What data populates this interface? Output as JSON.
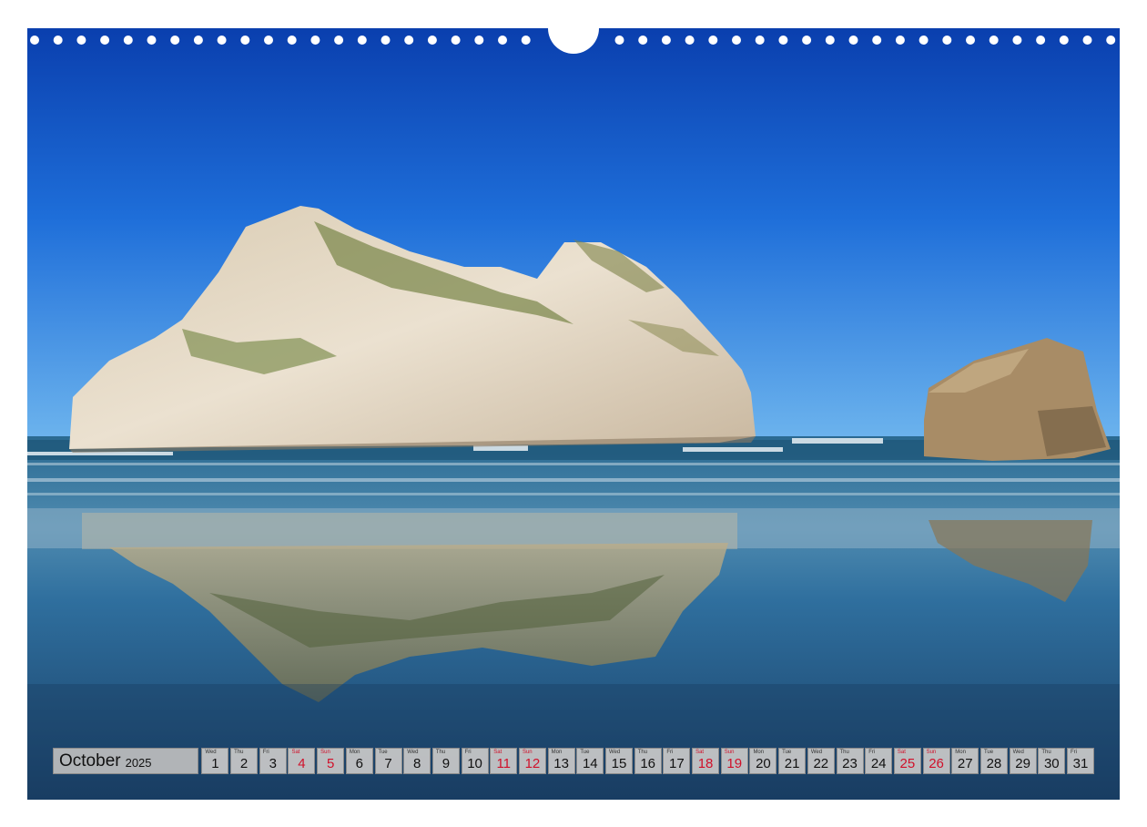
{
  "calendar": {
    "month": "October",
    "year": "2025",
    "weekend_color": "#d0102a",
    "days": [
      {
        "weekday": "Wed",
        "day": "1",
        "weekend": false
      },
      {
        "weekday": "Thu",
        "day": "2",
        "weekend": false
      },
      {
        "weekday": "Fri",
        "day": "3",
        "weekend": false
      },
      {
        "weekday": "Sat",
        "day": "4",
        "weekend": true
      },
      {
        "weekday": "Sun",
        "day": "5",
        "weekend": true
      },
      {
        "weekday": "Mon",
        "day": "6",
        "weekend": false
      },
      {
        "weekday": "Tue",
        "day": "7",
        "weekend": false
      },
      {
        "weekday": "Wed",
        "day": "8",
        "weekend": false
      },
      {
        "weekday": "Thu",
        "day": "9",
        "weekend": false
      },
      {
        "weekday": "Fri",
        "day": "10",
        "weekend": false
      },
      {
        "weekday": "Sat",
        "day": "11",
        "weekend": true
      },
      {
        "weekday": "Sun",
        "day": "12",
        "weekend": true
      },
      {
        "weekday": "Mon",
        "day": "13",
        "weekend": false
      },
      {
        "weekday": "Tue",
        "day": "14",
        "weekend": false
      },
      {
        "weekday": "Wed",
        "day": "15",
        "weekend": false
      },
      {
        "weekday": "Thu",
        "day": "16",
        "weekend": false
      },
      {
        "weekday": "Fri",
        "day": "17",
        "weekend": false
      },
      {
        "weekday": "Sat",
        "day": "18",
        "weekend": true
      },
      {
        "weekday": "Sun",
        "day": "19",
        "weekend": true
      },
      {
        "weekday": "Mon",
        "day": "20",
        "weekend": false
      },
      {
        "weekday": "Tue",
        "day": "21",
        "weekend": false
      },
      {
        "weekday": "Wed",
        "day": "22",
        "weekend": false
      },
      {
        "weekday": "Thu",
        "day": "23",
        "weekend": false
      },
      {
        "weekday": "Fri",
        "day": "24",
        "weekend": false
      },
      {
        "weekday": "Sat",
        "day": "25",
        "weekend": true
      },
      {
        "weekday": "Sun",
        "day": "26",
        "weekend": true
      },
      {
        "weekday": "Mon",
        "day": "27",
        "weekend": false
      },
      {
        "weekday": "Tue",
        "day": "28",
        "weekend": false
      },
      {
        "weekday": "Wed",
        "day": "29",
        "weekend": false
      },
      {
        "weekday": "Thu",
        "day": "30",
        "weekend": false
      },
      {
        "weekday": "Fri",
        "day": "31",
        "weekend": false
      }
    ]
  },
  "photo": {
    "sky_color": "#0f5ccf",
    "sea_color": "#1e4f7a",
    "rock_color": "#e3d6c1"
  }
}
